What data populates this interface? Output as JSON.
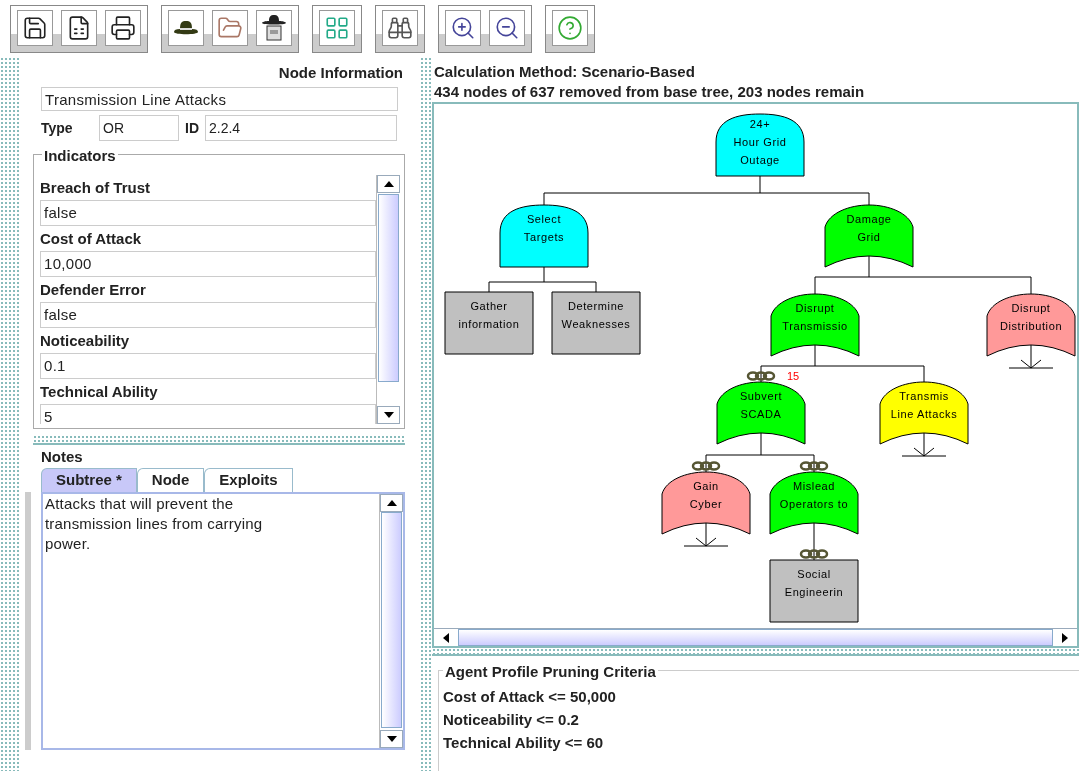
{
  "node_information": {
    "title": "Node Information",
    "name": "Transmission Line Attacks",
    "type_label": "Type",
    "type": "OR",
    "id_label": "ID",
    "id": "2.2.4"
  },
  "indicators": {
    "title": "Indicators",
    "items": [
      {
        "label": "Breach of Trust",
        "value": "false"
      },
      {
        "label": "Cost of Attack",
        "value": "10,000"
      },
      {
        "label": "Defender Error",
        "value": "false"
      },
      {
        "label": "Noticeability",
        "value": "0.1"
      },
      {
        "label": "Technical Ability",
        "value": "5"
      }
    ]
  },
  "notes": {
    "title": "Notes",
    "tabs": [
      {
        "label": "Subtree *",
        "selected": true
      },
      {
        "label": "Node",
        "selected": false
      },
      {
        "label": "Exploits",
        "selected": false
      }
    ],
    "text": "Attacks that will prevent the transmission lines from carrying power."
  },
  "calculation": {
    "method": "Calculation Method: Scenario-Based",
    "summary": "434 nodes of 637 removed from base tree, 203 nodes remain"
  },
  "tree": {
    "label_lines": [
      "24+",
      "Hour Grid",
      "Outage"
    ],
    "kind": "and",
    "color": "#00ffff",
    "collapsed": false,
    "linked": false,
    "children": [
      {
        "label_lines": [
          "Select",
          "Targets"
        ],
        "kind": "and",
        "color": "#00ffff",
        "collapsed": false,
        "linked": false,
        "children": [
          {
            "label_lines": [
              "Gather",
              "information"
            ],
            "kind": "leaf",
            "color": "#c0c0c0",
            "collapsed": false,
            "linked": false
          },
          {
            "label_lines": [
              "Determine",
              "Weaknesses"
            ],
            "kind": "leaf",
            "color": "#c0c0c0",
            "collapsed": false,
            "linked": false
          }
        ]
      },
      {
        "label_lines": [
          "Damage",
          "Grid"
        ],
        "kind": "or",
        "color": "#00ff00",
        "collapsed": false,
        "linked": false,
        "children": [
          {
            "label_lines": [
              "Disrupt",
              "Transmissio"
            ],
            "kind": "or",
            "color": "#00ff00",
            "collapsed": false,
            "linked": false,
            "children": [
              {
                "label_lines": [
                  "Subvert",
                  "SCADA"
                ],
                "kind": "or",
                "color": "#00ff00",
                "collapsed": false,
                "linked": true,
                "badge": "15",
                "children": [
                  {
                    "label_lines": [
                      "Gain",
                      "Cyber"
                    ],
                    "kind": "or",
                    "color": "#ff9999",
                    "collapsed": true,
                    "linked": true
                  },
                  {
                    "label_lines": [
                      "Mislead",
                      "Operators to"
                    ],
                    "kind": "or",
                    "color": "#00ff00",
                    "collapsed": false,
                    "linked": true,
                    "children": [
                      {
                        "label_lines": [
                          "Social",
                          "Engineerin"
                        ],
                        "kind": "leaf",
                        "color": "#c0c0c0",
                        "collapsed": false,
                        "linked": true
                      }
                    ]
                  }
                ]
              },
              {
                "label_lines": [
                  "Transmis",
                  "Line Attacks"
                ],
                "kind": "or",
                "color": "#ffff00",
                "collapsed": true,
                "linked": false
              }
            ]
          },
          {
            "label_lines": [
              "Disrupt",
              "Distribution"
            ],
            "kind": "or",
            "color": "#ff9999",
            "collapsed": true,
            "linked": false
          }
        ]
      }
    ]
  },
  "pruning_criteria": {
    "title": "Agent Profile Pruning Criteria",
    "items": [
      "Cost of Attack <= 50,000",
      "Noticeability <= 0.2",
      "Technical Ability <= 60"
    ]
  }
}
